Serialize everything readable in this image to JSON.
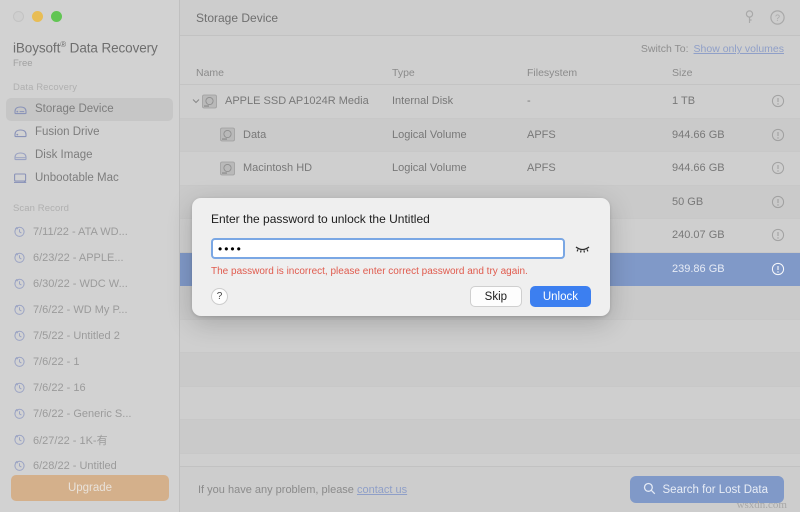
{
  "window": {
    "traffic_lights": [
      "close",
      "minimize",
      "maximize"
    ]
  },
  "sidebar": {
    "brand_name": "iBoysoft",
    "brand_sup": "®",
    "brand_rest": " Data Recovery",
    "brand_plan": "Free",
    "section_data_recovery": "Data Recovery",
    "nav_items": [
      {
        "label": "Storage Device",
        "icon": "storage-device-icon",
        "active": true
      },
      {
        "label": "Fusion Drive",
        "icon": "fusion-drive-icon",
        "active": false
      },
      {
        "label": "Disk Image",
        "icon": "disk-image-icon",
        "active": false
      },
      {
        "label": "Unbootable Mac",
        "icon": "unbootable-mac-icon",
        "active": false
      }
    ],
    "section_scan_record": "Scan Record",
    "scan_records": [
      {
        "label": "7/11/22 - ATA WD..."
      },
      {
        "label": "6/23/22 - APPLE..."
      },
      {
        "label": "6/30/22 - WDC W..."
      },
      {
        "label": "7/6/22 - WD My P..."
      },
      {
        "label": "7/5/22 - Untitled 2"
      },
      {
        "label": "7/6/22 - 1"
      },
      {
        "label": "7/6/22 - 16"
      },
      {
        "label": "7/6/22 - Generic S..."
      },
      {
        "label": "6/27/22 - 1K-有"
      },
      {
        "label": "6/28/22 - Untitled"
      }
    ],
    "upgrade_label": "Upgrade"
  },
  "header": {
    "title": "Storage Device",
    "icons": [
      {
        "name": "key-icon"
      },
      {
        "name": "help-circle-icon"
      }
    ]
  },
  "switch_bar": {
    "label": "Switch To:",
    "link": "Show only volumes"
  },
  "table": {
    "columns": [
      "Name",
      "Type",
      "Filesystem",
      "Size"
    ],
    "rows": [
      {
        "name": "APPLE SSD AP1024R Media",
        "type": "Internal Disk",
        "fs": "-",
        "size": "1 TB",
        "child": false,
        "expanded": true,
        "selected": false
      },
      {
        "name": "Data",
        "type": "Logical Volume",
        "fs": "APFS",
        "size": "944.66 GB",
        "child": true,
        "expanded": false,
        "selected": false
      },
      {
        "name": "Macintosh HD",
        "type": "Logical Volume",
        "fs": "APFS",
        "size": "944.66 GB",
        "child": true,
        "expanded": false,
        "selected": false
      },
      {
        "name": "",
        "type": "",
        "fs": "",
        "size": "50 GB",
        "child": true,
        "expanded": false,
        "selected": false
      },
      {
        "name": "",
        "type": "",
        "fs": "",
        "size": "240.07 GB",
        "child": true,
        "expanded": false,
        "selected": false
      },
      {
        "name": "",
        "type": "",
        "fs": "",
        "size": "239.86 GB",
        "child": true,
        "expanded": false,
        "selected": true
      }
    ]
  },
  "dialog": {
    "title": "Enter the password to unlock the Untitled",
    "password_value": "••••",
    "password_placeholder": "",
    "error": "The password is incorrect, please enter correct password and try again.",
    "help_label": "?",
    "skip_label": "Skip",
    "unlock_label": "Unlock",
    "reveal_icon": "eye-closed-icon"
  },
  "footer": {
    "text_before": "If you have any problem, please ",
    "link": "contact us",
    "search_label": "Search for Lost Data",
    "watermark": "wsxdn.com"
  },
  "colors": {
    "accent_blue": "#3c7ff0",
    "selected_row": "#8099c8",
    "error_red": "#e05b4e",
    "upgrade_tan": "#d4b08b",
    "link_blue": "#8f9fc8"
  }
}
